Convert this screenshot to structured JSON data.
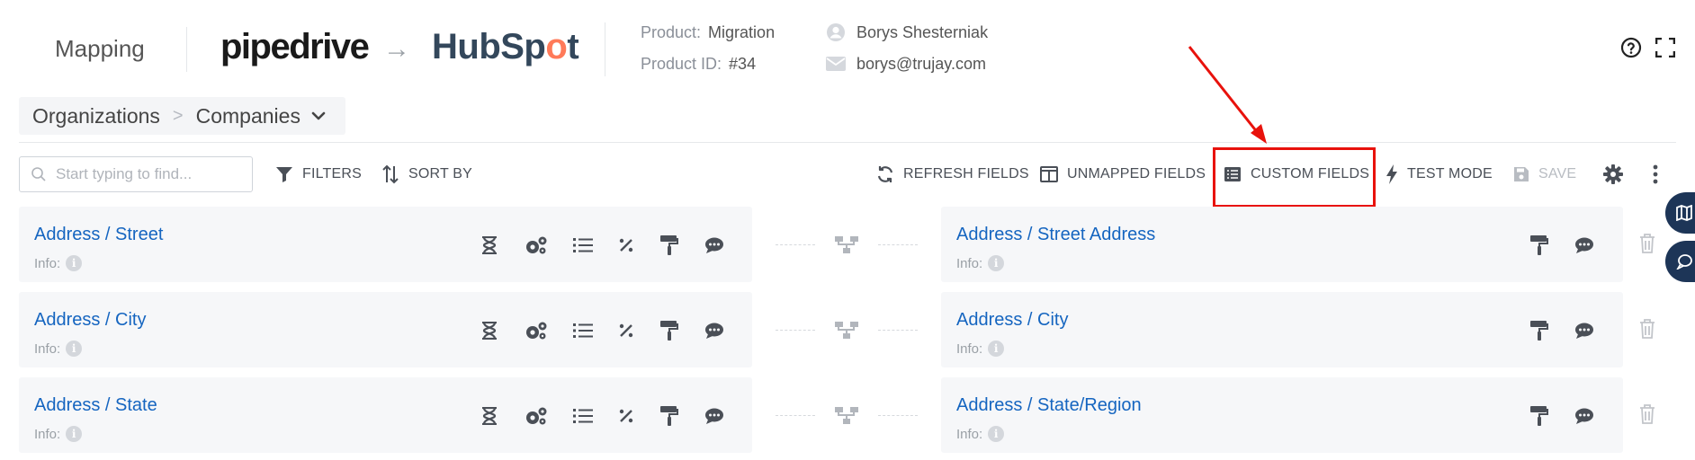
{
  "header": {
    "title": "Mapping",
    "source_logo": "pipedrive",
    "target_logo_left": "HubSp",
    "target_logo_o": "o",
    "target_logo_right": "t",
    "product_label": "Product:",
    "product_value": "Migration",
    "product_id_label": "Product ID:",
    "product_id_value": "#34",
    "user_name": "Borys Shesterniak",
    "user_email": "borys@trujay.com"
  },
  "breadcrumb": {
    "parent": "Organizations",
    "separator": ">",
    "current": "Companies"
  },
  "toolbar": {
    "search_placeholder": "Start typing to find...",
    "filters": "FILTERS",
    "sort_by": "SORT BY",
    "refresh_fields": "REFRESH FIELDS",
    "unmapped_fields": "UNMAPPED FIELDS",
    "custom_fields": "CUSTOM FIELDS",
    "test_mode": "TEST MODE",
    "save": "SAVE"
  },
  "rows": [
    {
      "source_field": "Address / Street",
      "source_info": "Info:",
      "target_field": "Address / Street Address",
      "target_info": "Info:"
    },
    {
      "source_field": "Address / City",
      "source_info": "Info:",
      "target_field": "Address / City",
      "target_info": "Info:"
    },
    {
      "source_field": "Address / State",
      "source_info": "Info:",
      "target_field": "Address / State/Region",
      "target_info": "Info:"
    }
  ],
  "colors": {
    "link_blue": "#1565c0",
    "annotation_red": "#e8120c",
    "hubspot_orange": "#ff7a59",
    "side_tab_navy": "#1d3557"
  },
  "icons": [
    "question-icon",
    "fullscreen-icon",
    "user-icon",
    "mail-icon",
    "search-icon",
    "filter-icon",
    "sort-icon",
    "refresh-icon",
    "columns-icon",
    "list-icon",
    "bolt-icon",
    "floppy-icon",
    "gear-icon",
    "kebab-icon",
    "hourglass-icon",
    "cogs-icon",
    "list-bullets-icon",
    "percent-icon",
    "paint-roller-icon",
    "comment-icon",
    "sitemap-icon",
    "trash-icon",
    "map-icon",
    "chat-icon"
  ]
}
